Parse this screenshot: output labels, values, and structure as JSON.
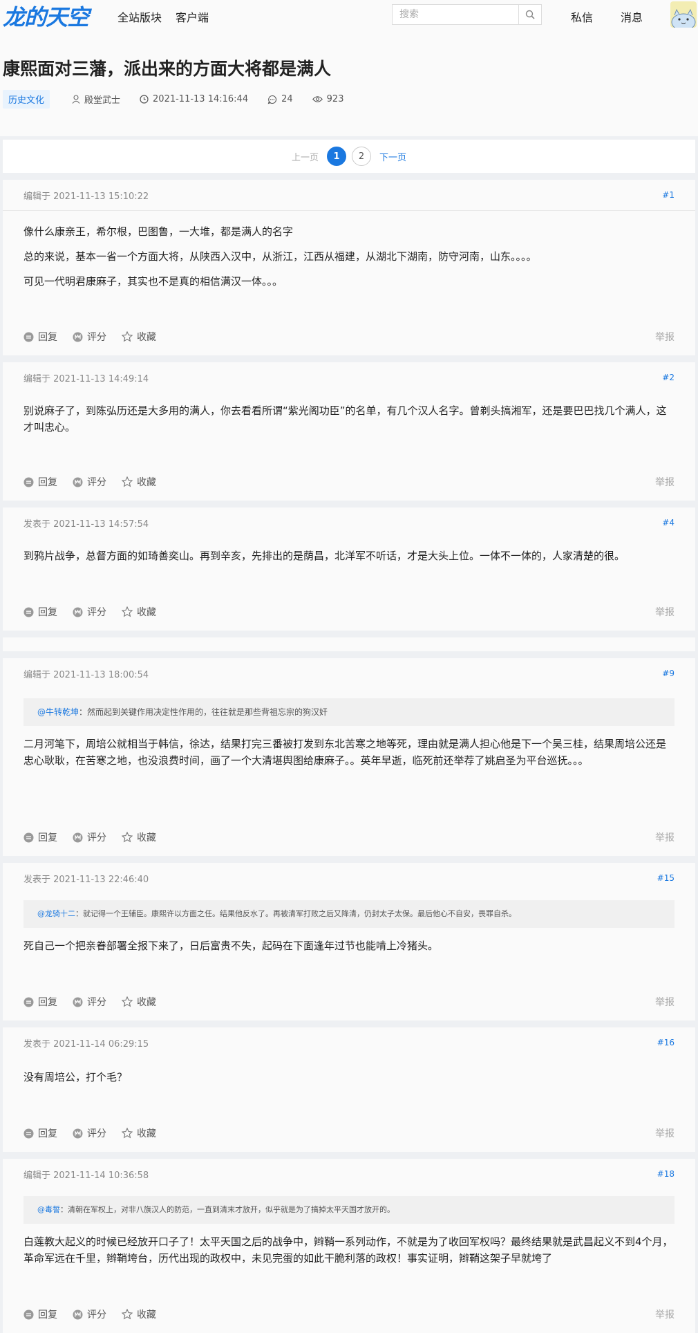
{
  "header": {
    "logo_text": "龙的天空",
    "nav_all_boards": "全站版块",
    "nav_client": "客户端",
    "search_placeholder": "搜索",
    "nav_messages": "私信",
    "nav_notifications": "消息"
  },
  "thread": {
    "title": "康熙面对三藩，派出来的方面大将都是满人",
    "tag": "历史文化",
    "author": "殿堂武士",
    "datetime": "2021-11-13 14:16:44",
    "replies": "24",
    "views": "923"
  },
  "pager": {
    "prev": "上一页",
    "pages": [
      "1",
      "2"
    ],
    "current": "1",
    "next": "下一页"
  },
  "actions": {
    "reply": "回复",
    "rate": "评分",
    "favorite": "收藏",
    "report": "举报"
  },
  "posts": [
    {
      "meta": "编辑于 2021-11-13 15:10:22",
      "floor": "#1",
      "paragraphs": [
        "像什么康亲王，希尔根，巴图鲁，一大堆，都是满人的名字",
        "总的来说，基本一省一个方面大将，从陕西入汉中，从浙江，江西从福建，从湖北下湖南，防守河南，山东。。。。",
        "可见一代明君康麻子，其实也不是真的相信满汉一体。。。"
      ]
    },
    {
      "meta": "编辑于 2021-11-13 14:49:14",
      "floor": "#2",
      "paragraphs": [
        "别说麻子了，到陈弘历还是大多用的满人，你去看看所谓“紫光阁功臣”的名单，有几个汉人名字。曾剃头搞湘军，还是要巴巴找几个满人，这才叫忠心。"
      ]
    },
    {
      "meta": "发表于 2021-11-13 14:57:54",
      "floor": "#4",
      "paragraphs": [
        "到鸦片战争，总督方面的如琦善奕山。再到辛亥，先排出的是荫昌，北洋军不听话，才是大头上位。一体不一体的，人家清楚的很。"
      ]
    },
    {
      "meta": "编辑于 2021-11-13 18:00:54",
      "floor": "#9",
      "quote_name": "@牛转乾坤",
      "quote_text": "：然而起到关键作用决定性作用的，往往就是那些背祖忘宗的狗汉奸",
      "paragraphs": [
        "二月河笔下，周培公就相当于韩信，徐达，结果打完三番被打发到东北苦寒之地等死，理由就是满人担心他是下一个吴三桂，结果周培公还是忠心耿耿，在苦寒之地，也没浪费时间，画了一个大清堪舆图给康麻子。。英年早逝，临死前还举荐了姚启圣为平台巡抚。。。"
      ]
    },
    {
      "meta": "发表于 2021-11-13 22:46:40",
      "floor": "#15",
      "quote_name": "@龙骑十二",
      "quote_text": "：就记得一个王辅臣。康熙许以方面之任。结果他反水了。再被清军打败之后又降清，仍封太子太保。最后他心不自安，畏罪自杀。",
      "paragraphs": [
        "死自己一个把亲眷部署全报下来了，日后富贵不失，起码在下面逢年过节也能啃上冷猪头。"
      ]
    },
    {
      "meta": "发表于 2021-11-14 06:29:15",
      "floor": "#16",
      "paragraphs": [
        "没有周培公，打个毛？"
      ]
    },
    {
      "meta": "编辑于 2021-11-14 10:36:58",
      "floor": "#18",
      "quote_name": "@毒誓",
      "quote_text": "：清朝在军权上，对非八旗汉人的防范，一直到清末才放开，似乎就是为了搞掉太平天国才放开的。",
      "paragraphs": [
        "白莲教大起义的时候已经放开口子了！太平天国之后的战争中，辫鞘一系列动作，不就是为了收回军权吗？最终结果就是武昌起义不到4个月，革命军远在千里，辫鞘垮台，历代出现的政权中，未见完蛋的如此干脆利落的政权！事实证明，辫鞘这架子早就垮了"
      ]
    }
  ],
  "colors": {
    "accent": "#1a78e0",
    "page_bg": "#eef0f3",
    "card_bg": "#fafafa"
  }
}
